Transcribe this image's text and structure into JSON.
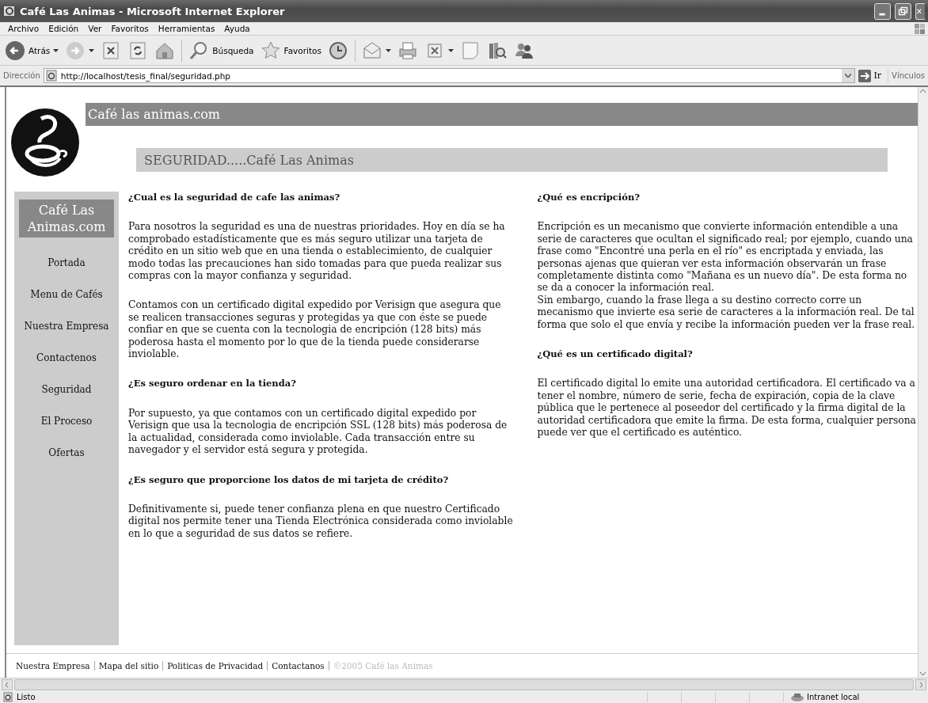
{
  "window": {
    "title": "Café Las Animas - Microsoft Internet Explorer"
  },
  "menu": [
    "Archivo",
    "Edición",
    "Ver",
    "Favoritos",
    "Herramientas",
    "Ayuda"
  ],
  "toolbar": [
    {
      "kind": "back",
      "label": "Atrás",
      "dropdown": true
    },
    {
      "kind": "forward",
      "dropdown": true
    },
    {
      "kind": "stop"
    },
    {
      "kind": "refresh"
    },
    {
      "kind": "home"
    },
    {
      "kind": "search",
      "label": "Búsqueda"
    },
    {
      "kind": "favorites",
      "label": "Favoritos"
    },
    {
      "kind": "history"
    },
    {
      "kind": "mail",
      "dropdown": true
    },
    {
      "kind": "print"
    },
    {
      "kind": "edit",
      "dropdown": true
    },
    {
      "kind": "note"
    },
    {
      "kind": "research"
    },
    {
      "kind": "messenger"
    }
  ],
  "address": {
    "label": "Dirección",
    "value": "http://localhost/tesis_final/seguridad.php",
    "go": "Ir",
    "links": "Vínculos"
  },
  "site": {
    "brand": "Café las animas.com",
    "heading": "SEGURIDAD.....Café Las Animas",
    "sidebar_title": "Café Las Animas.com",
    "nav": [
      "Portada",
      "Menu de Cafés",
      "Nuestra Empresa",
      "Contactenos",
      "Seguridad",
      "El Proceso",
      "Ofertas"
    ],
    "columns": [
      [
        {
          "kind": "heading",
          "text": "¿Cual es la seguridad de cafe las animas?"
        },
        {
          "kind": "paragraph",
          "text": "Para nosotros la seguridad es una de nuestras prioridades. Hoy en día se ha comprobado estadísticamente que es más seguro utilizar una tarjeta de crédito en un sitio web que en una tienda o establecimiento, de cualquier modo todas las precauciones han sido tomadas para que pueda realizar sus compras con la mayor confianza y seguridad."
        },
        {
          "kind": "paragraph",
          "text": "Contamos con un certificado digital expedido por Verisign que asegura que se realicen transacciones seguras y protegidas ya que con éste se puede confiar en que se cuenta con la tecnologia de encripción (128 bits) más poderosa hasta el momento por lo que de la tienda puede considerarse inviolable."
        },
        {
          "kind": "heading",
          "text": "¿Es seguro ordenar en la tienda?"
        },
        {
          "kind": "paragraph",
          "text": "Por supuesto, ya que contamos con un certificado digital expedido por Verisign que usa la tecnologia de encripción SSL (128 bits) más poderosa de la actualidad, considerada como inviolable. Cada transacción entre su navegador y el servidor está segura y protegida."
        },
        {
          "kind": "heading",
          "text": "¿Es seguro que proporcione los datos de mi tarjeta de crédito?"
        },
        {
          "kind": "paragraph",
          "text": "Definitivamente si, puede tener confianza plena en que nuestro Certificado digital nos permite tener una Tienda Electrónica considerada como inviolable en lo que a seguridad de sus datos se refiere."
        }
      ],
      [
        {
          "kind": "heading",
          "text": "¿Qué es encripción?"
        },
        {
          "kind": "paragraph",
          "text": "Encripción es un mecanismo que convierte información entendible a una serie de caracteres que ocultan el significado real; por ejemplo, cuando una frase como \"Encontré una perla en el río\" es encriptada y enviada, las personas ajenas que quieran ver esta información observarán un frase completamente distinta como \"Mañana es un nuevo día\". De esta forma no se da a conocer la información real.\nSin embargo, cuando la frase llega a su destino correcto corre un mecanismo que invierte esa serie de caracteres a la información real. De tal forma que solo el que envía y recibe la información pueden ver la frase real."
        },
        {
          "kind": "heading",
          "text": "¿Qué es un certificado digital?"
        },
        {
          "kind": "paragraph",
          "text": "El certificado digital lo emite una autoridad certificadora. El certificado va a tener el nombre, número de serie, fecha de expiración, copia de la clave pública que le pertenece al poseedor del certificado y la firma digital de la autoridad certificadora que emite la firma. De esta forma, cualquier persona puede ver que el certificado es auténtico."
        }
      ]
    ],
    "footer": {
      "links": [
        "Nuestra Empresa",
        "Mapa del sitio",
        "Politicas de Privacidad",
        "Contactanos"
      ],
      "copyright": "©2005 Café las Animas"
    }
  },
  "status_bar": {
    "text": "Listo",
    "zone": "Intranet local"
  }
}
